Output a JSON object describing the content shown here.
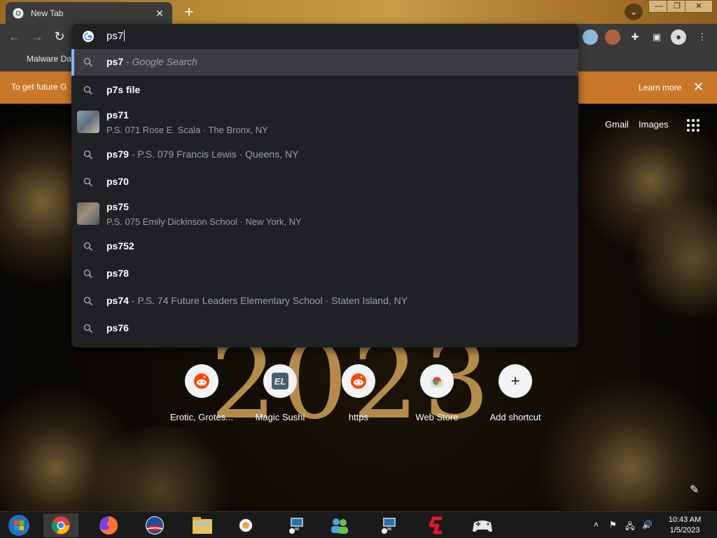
{
  "tab": {
    "title": "New Tab"
  },
  "omnibox": {
    "input_value": "ps7",
    "suggestions": [
      {
        "query": "ps7",
        "description": " - Google Search",
        "selected": true
      },
      {
        "query": "p7s file"
      },
      {
        "query": "ps71",
        "subtitle": "P.S. 071 Rose E. Scala · The Bronx, NY",
        "thumbnail": true
      },
      {
        "query": "ps79",
        "description": " - P.S. 079 Francis Lewis · Queens, NY"
      },
      {
        "query": "ps70"
      },
      {
        "query": "ps75",
        "subtitle": "P.S. 075 Emily Dickinson School · New York, NY",
        "thumbnail": true
      },
      {
        "query": "ps752"
      },
      {
        "query": "ps78"
      },
      {
        "query": "ps74",
        "description": " - P.S. 74 Future Leaders Elementary School · Staten Island, NY"
      },
      {
        "query": "ps76"
      }
    ]
  },
  "bookmarks": {
    "item": "Malware Dat"
  },
  "infobar": {
    "text": "To get future G",
    "learn_more": "Learn more"
  },
  "ntp": {
    "gmail": "Gmail",
    "images": "Images",
    "year_text": "2023",
    "shortcuts": [
      {
        "label": "Erotic, Grotes...",
        "icon": "reddit-icon"
      },
      {
        "label": "Magic Sushi",
        "icon": "el-icon"
      },
      {
        "label": "https",
        "icon": "reddit-icon"
      },
      {
        "label": "Web Store",
        "icon": "webstore-icon"
      },
      {
        "label": "Add shortcut",
        "icon": "plus-icon"
      }
    ]
  },
  "taskbar": {
    "time": "10:43 AM",
    "date": "1/5/2023"
  },
  "colors": {
    "omnibox_bg": "#202124",
    "selected_row": "#3c3d40",
    "infobar": "#c9782a",
    "chrome_dark": "#3a3a3a"
  }
}
